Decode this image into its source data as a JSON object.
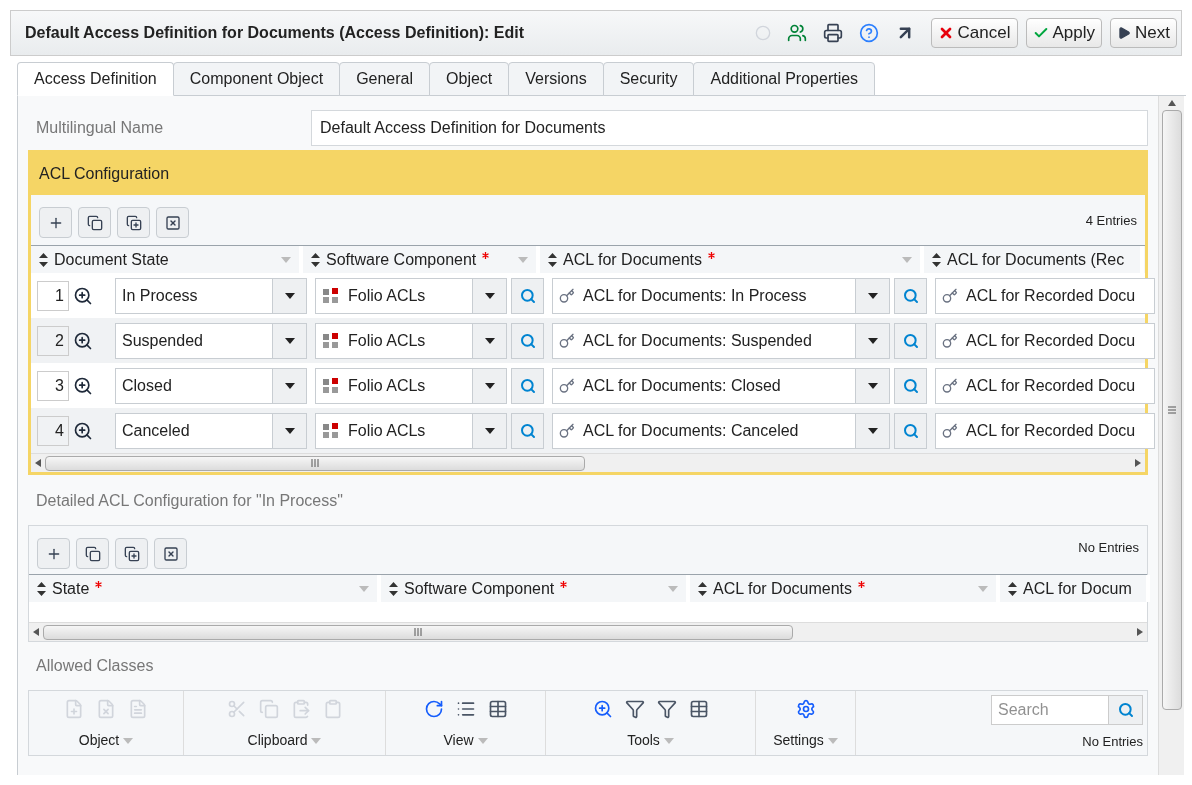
{
  "window": {
    "title": "Default Access Definition for Documents (Access Definition): Edit",
    "buttons": [
      {
        "kind": "cancel",
        "label": "Cancel"
      },
      {
        "kind": "apply",
        "label": "Apply"
      },
      {
        "kind": "next",
        "label": "Next"
      }
    ]
  },
  "tabs": [
    {
      "label": "Access Definition",
      "selected": true
    },
    {
      "label": "Component Object",
      "selected": false
    },
    {
      "label": "General",
      "selected": false
    },
    {
      "label": "Object",
      "selected": false
    },
    {
      "label": "Versions",
      "selected": false
    },
    {
      "label": "Security",
      "selected": false
    },
    {
      "label": "Additional Properties",
      "selected": false
    }
  ],
  "multilingual_name": {
    "label": "Multilingual Name",
    "value": "Default Access Definition for Documents"
  },
  "acl_configuration": {
    "title": "ACL Configuration",
    "count": "4 Entries",
    "columns": [
      {
        "label": "Document State",
        "required": false
      },
      {
        "label": "Software Component",
        "required": true
      },
      {
        "label": "ACL for Documents",
        "required": true
      },
      {
        "label": "ACL for Documents (Rec",
        "required": false
      }
    ],
    "rows": [
      {
        "number": "1",
        "document_state": "In Process",
        "software_component": "Folio ACLs",
        "acl": "ACL for Documents: In Process",
        "acl_recorded": "ACL for Recorded Docu"
      },
      {
        "number": "2",
        "document_state": "Suspended",
        "software_component": "Folio ACLs",
        "acl": "ACL for Documents: Suspended",
        "acl_recorded": "ACL for Recorded Docu"
      },
      {
        "number": "3",
        "document_state": "Closed",
        "software_component": "Folio ACLs",
        "acl": "ACL for Documents: Closed",
        "acl_recorded": "ACL for Recorded Docu"
      },
      {
        "number": "4",
        "document_state": "Canceled",
        "software_component": "Folio ACLs",
        "acl": "ACL for Documents: Canceled",
        "acl_recorded": "ACL for Recorded Docu"
      }
    ]
  },
  "detailed_acl_configuration": {
    "title": "Detailed ACL Configuration for \"In Process\"",
    "count": "No Entries",
    "columns": [
      {
        "label": "State",
        "required": true
      },
      {
        "label": "Software Component",
        "required": true
      },
      {
        "label": "ACL for Documents",
        "required": true
      },
      {
        "label": "ACL for Docum",
        "required": false
      }
    ]
  },
  "allowed_classes": {
    "title": "Allowed Classes",
    "groups": [
      {
        "label": "Object"
      },
      {
        "label": "Clipboard"
      },
      {
        "label": "View"
      },
      {
        "label": "Tools"
      },
      {
        "label": "Settings"
      }
    ],
    "search": {
      "placeholder": "Search"
    },
    "count": "No Entries"
  }
}
